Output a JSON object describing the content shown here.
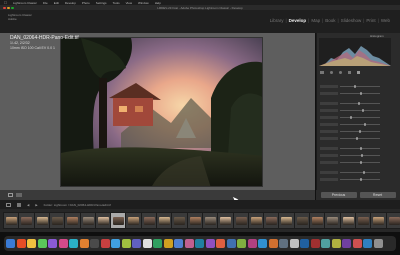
{
  "menubar": {
    "app": "Lightroom Classic",
    "items": [
      "File",
      "Edit",
      "Develop",
      "Photo",
      "Settings",
      "Tools",
      "View",
      "Window",
      "Help"
    ],
    "clock": ""
  },
  "window": {
    "title": "LRDEV-23.lrcat - Adobe Photoshop Lightroom Classic - Develop"
  },
  "identity": {
    "line1": "Lightroom Classic",
    "line2": "Adobe"
  },
  "modules": [
    "Library",
    "Develop",
    "Map",
    "Book",
    "Slideshow",
    "Print",
    "Web"
  ],
  "active_module": "Develop",
  "photo_info": {
    "filename": "DAN_02064-HDR-Pano-Edit.tif",
    "line2": "1/-42, 2/2/32",
    "line3": "10mm   ISO 100  Cali EV 0.0 1"
  },
  "right_panel": {
    "histogram_label": "Histogram",
    "presets_label": "",
    "previous_label": "Previous",
    "reset_label": "Reset"
  },
  "filmstrip": {
    "label": "Folder: Lightroom / DAN_02064-HDR-Pano-Edit.tif",
    "count": 26,
    "selected_index": 7
  },
  "colors": {
    "accent": "#f0f0f0",
    "panel": "#2b2b2b",
    "center": "#5e5e5e"
  }
}
